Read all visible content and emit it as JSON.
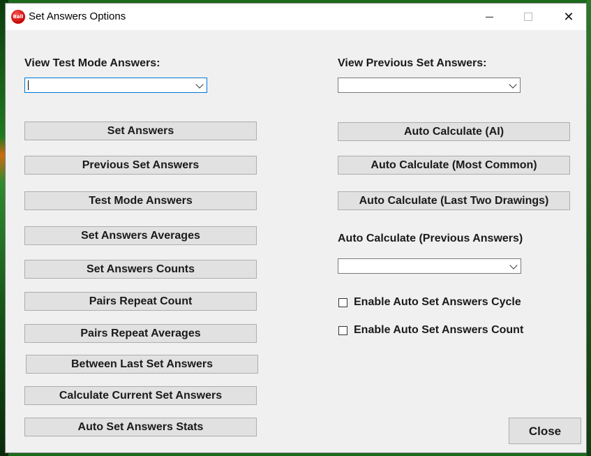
{
  "window": {
    "title": "Set Answers Options",
    "icon_text": "Ball",
    "close_glyph": "✕"
  },
  "left": {
    "combo_label": "View Test Mode Answers:",
    "combo_value": "",
    "buttons": [
      "Set Answers",
      "Previous Set Answers",
      "Test Mode Answers",
      "Set Answers Averages",
      "Set Answers Counts",
      "Pairs Repeat Count",
      "Pairs Repeat Averages",
      "Between Last Set Answers",
      "Calculate Current Set Answers",
      "Auto Set Answers Stats"
    ]
  },
  "right": {
    "combo_label": "View Previous Set Answers:",
    "combo_value": "",
    "buttons": [
      "Auto Calculate (AI)",
      "Auto Calculate (Most Common)",
      "Auto Calculate (Last Two Drawings)"
    ],
    "prev_label": "Auto Calculate (Previous Answers)",
    "prev_combo_value": "",
    "checkboxes": [
      {
        "label": "Enable Auto Set Answers Cycle",
        "checked": false
      },
      {
        "label": "Enable Auto Set Answers Count",
        "checked": false
      }
    ]
  },
  "footer": {
    "close_label": "Close"
  }
}
